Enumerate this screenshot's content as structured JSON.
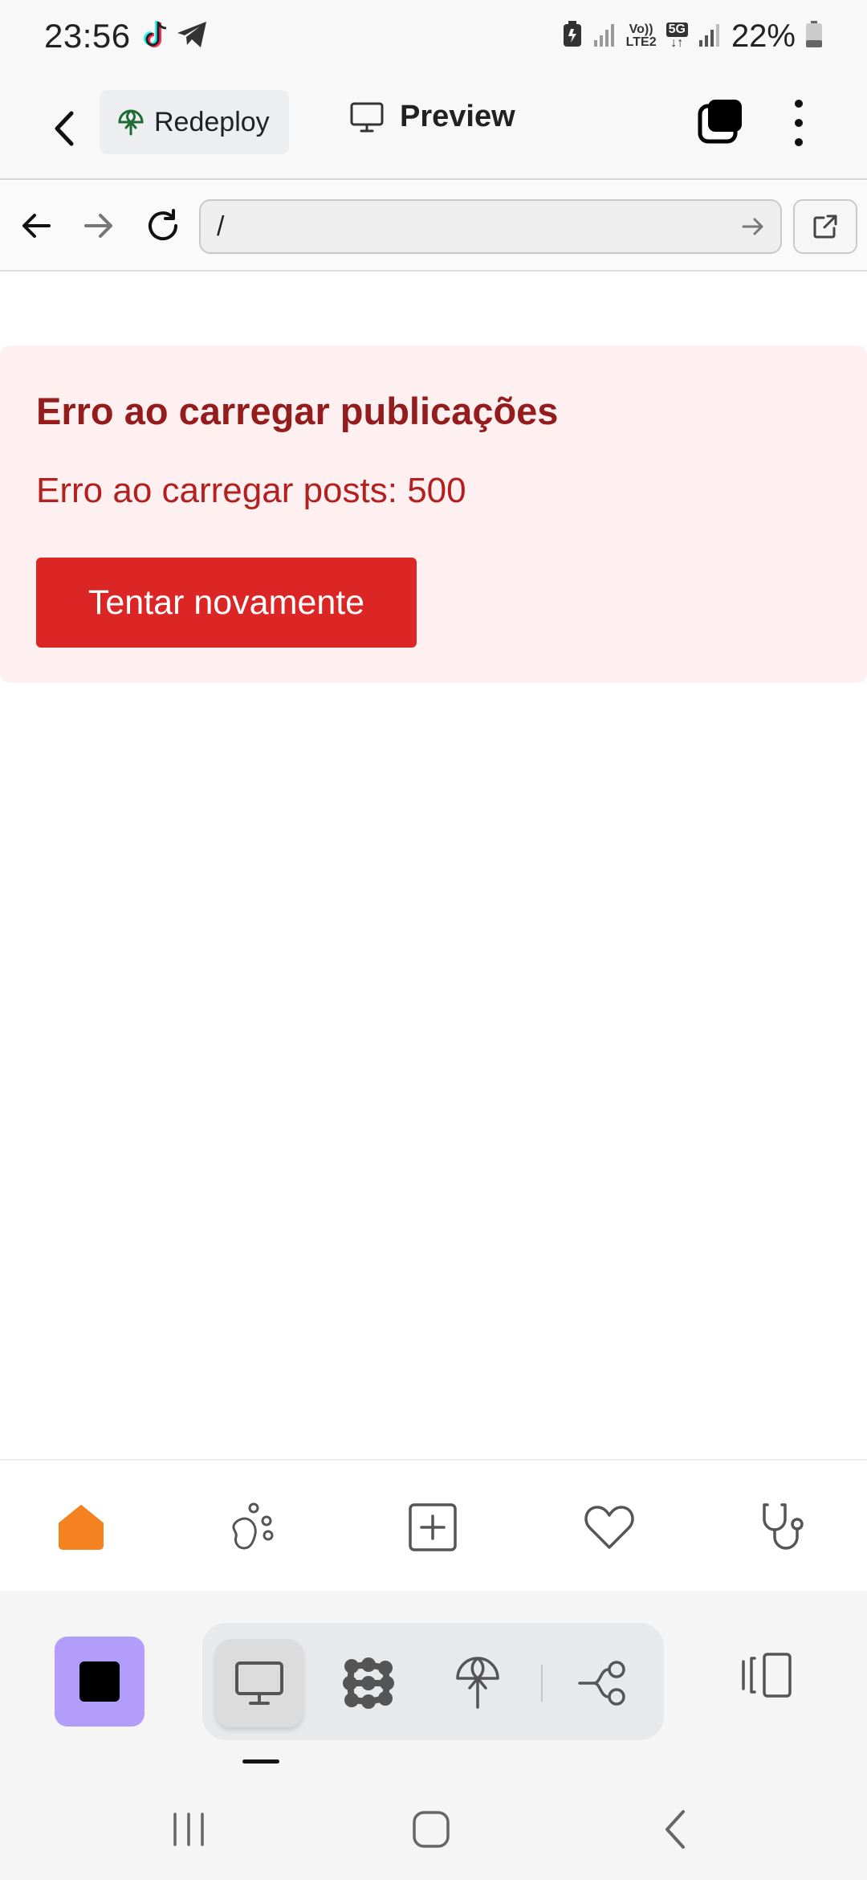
{
  "status_bar": {
    "time": "23:56",
    "battery_text": "22%",
    "volte_label_top": "Vo))",
    "volte_label_bottom": "LTE2",
    "network_label": "5G"
  },
  "app_bar": {
    "redeploy_label": "Redeploy",
    "preview_label": "Preview"
  },
  "browser": {
    "url": "/"
  },
  "error": {
    "title": "Erro ao carregar publicações",
    "message": "Erro ao carregar posts: 500",
    "retry_label": "Tentar novamente"
  },
  "bottom_nav": {
    "items": [
      "home-icon",
      "paw-icon",
      "add-icon",
      "heart-icon",
      "stethoscope-icon"
    ],
    "active": "home-icon",
    "active_color": "#f58220"
  },
  "dock": {
    "stop_color": "#b39dfb",
    "segments": [
      "preview-icon",
      "apps-icon",
      "deploy-icon",
      "workflow-icon"
    ],
    "active_segment": "preview-icon"
  }
}
